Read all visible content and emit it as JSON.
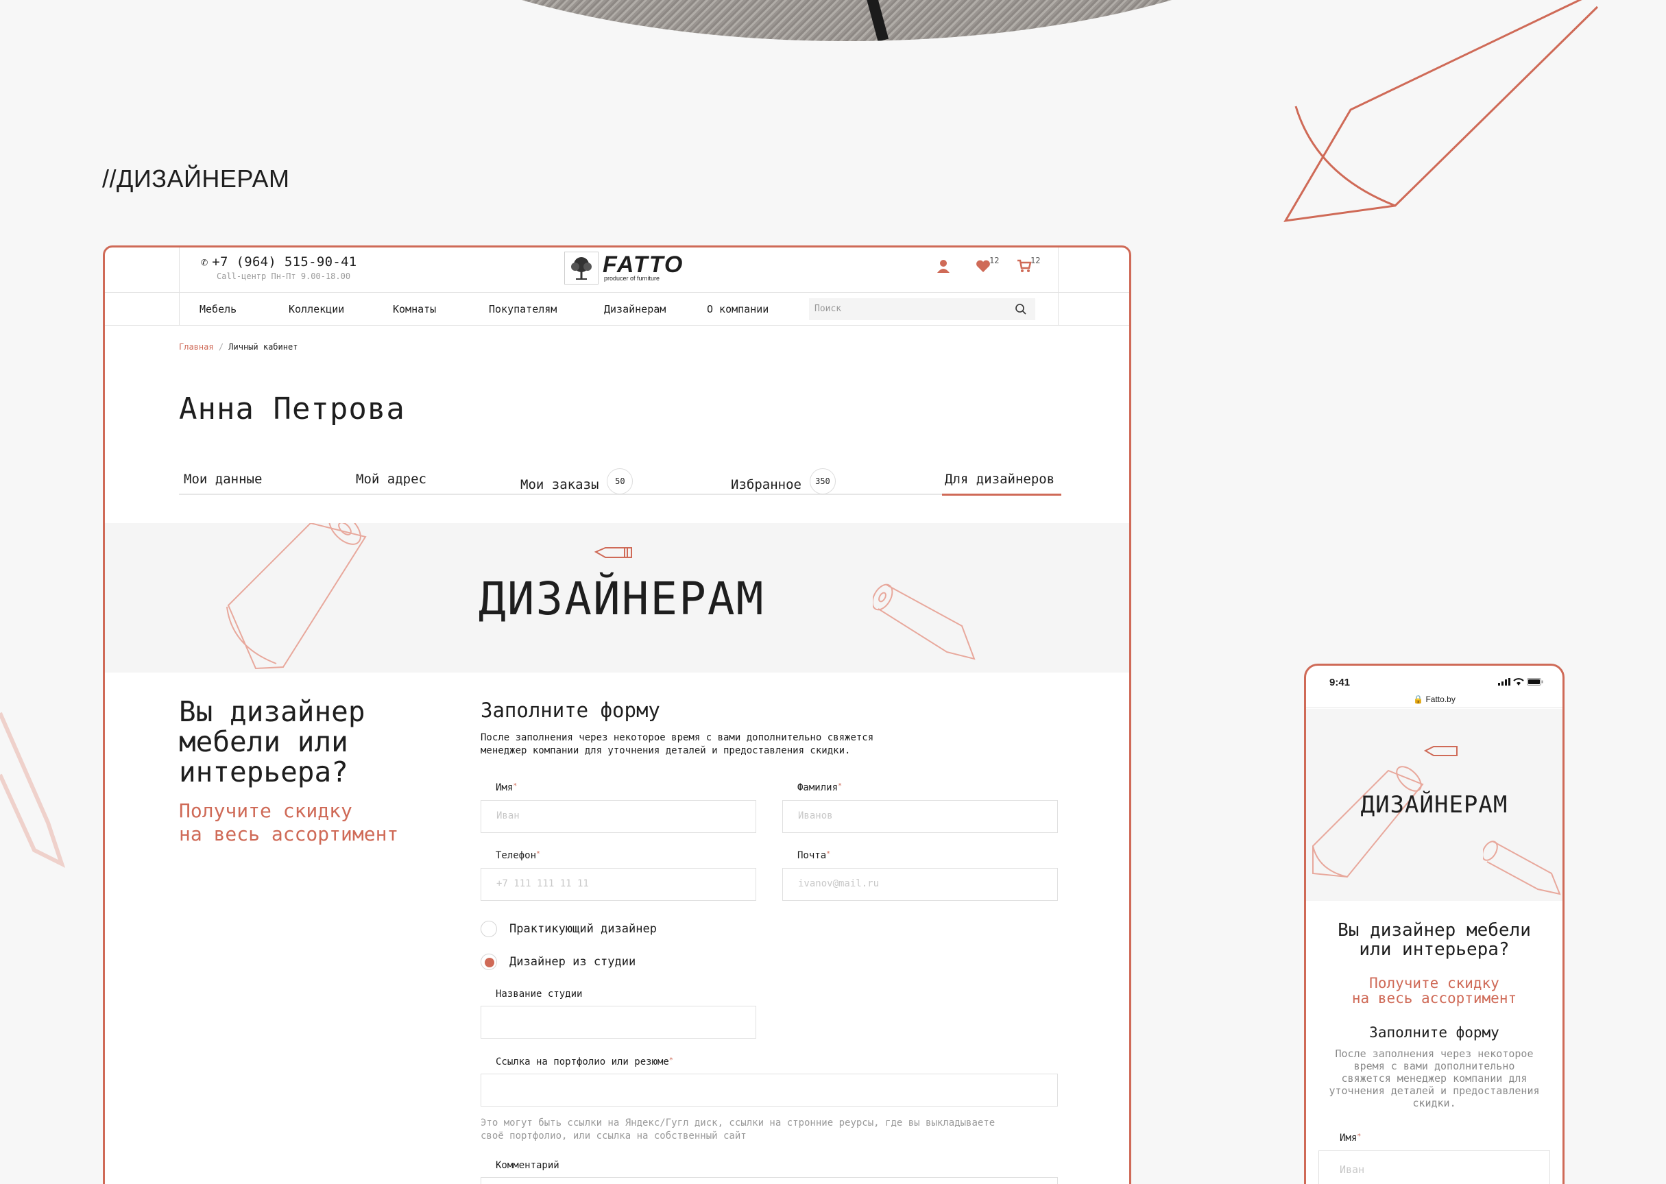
{
  "section_heading": "//ДИЗАЙНЕРАМ",
  "colors": {
    "accent": "#cf6a57",
    "text": "#1e1e1e",
    "muted": "#9a9a9a",
    "background": "#f7f7f7"
  },
  "header": {
    "phone": "+7 (964) 515-90-41",
    "phone_hours": "Call-центр Пн-Пт 9.00-18.00",
    "logo_name": "FATTO",
    "logo_tagline": "producer of furniture",
    "favorites_count": "12",
    "cart_count": "12"
  },
  "nav": {
    "items": [
      "Мебель",
      "Коллекции",
      "Комнаты",
      "Покупателям",
      "Дизайнерам",
      "О компании"
    ],
    "search_placeholder": "Поиск"
  },
  "breadcrumb": {
    "home": "Главная",
    "separator": "/",
    "current": "Личный кабинет"
  },
  "profile": {
    "name": "Анна Петрова"
  },
  "tabs": [
    {
      "label": "Мои данные",
      "badge": ""
    },
    {
      "label": "Мой адрес",
      "badge": ""
    },
    {
      "label": "Мои заказы",
      "badge": "50"
    },
    {
      "label": "Избранное",
      "badge": "350"
    },
    {
      "label": "Для дизайнеров",
      "badge": "",
      "active": true
    }
  ],
  "banner": {
    "title": "ДИЗАЙНЕРАМ"
  },
  "promo": {
    "question_lines": [
      "Вы дизайнер",
      "мебели или",
      "интерьера?"
    ],
    "offer_lines": [
      "Получите скидку",
      "на весь ассортимент"
    ]
  },
  "form": {
    "title": "Заполните форму",
    "description_lines": [
      "После заполнения через некоторое время с вами дополнительно свяжется",
      "менеджер компании для уточнения деталей и предоставления скидки."
    ],
    "first_name": {
      "label": "Имя",
      "placeholder": "Иван"
    },
    "last_name": {
      "label": "Фамилия",
      "placeholder": "Иванов"
    },
    "phone": {
      "label": "Телефон",
      "placeholder": "+7 111 111 11 11"
    },
    "email": {
      "label": "Почта",
      "placeholder": "ivanov@mail.ru"
    },
    "radio_practicing": "Практикующий дизайнер",
    "radio_studio": "Дизайнер из студии",
    "studio_name": {
      "label": "Название студии",
      "placeholder": ""
    },
    "portfolio": {
      "label": "Ссылка на портфолио или резюме",
      "placeholder": ""
    },
    "portfolio_hint_lines": [
      "Это могут быть ссылки на Яндекс/Гугл диск, ссылки на стронние реурсы, где вы выкладываете",
      "своё портфолио, или ссылка на собственный сайт"
    ],
    "comment": {
      "label": "Комментарий"
    },
    "required_mark": "*"
  },
  "mobile": {
    "time": "9:41",
    "url": "Fatto.by",
    "banner_title": "ДИЗАЙНЕРАМ",
    "question_lines": [
      "Вы дизайнер мебели",
      "или интерьера?"
    ],
    "offer_lines": [
      "Получите скидку",
      "на весь ассортимент"
    ],
    "form_title": "Заполните форму",
    "form_desc_lines": [
      "После заполнения через некоторое",
      "время с вами дополнительно",
      "свяжется менеджер компании для",
      "уточнения деталей и предоставления",
      "скидки."
    ],
    "name_label": "Имя",
    "name_placeholder": "Иван"
  }
}
